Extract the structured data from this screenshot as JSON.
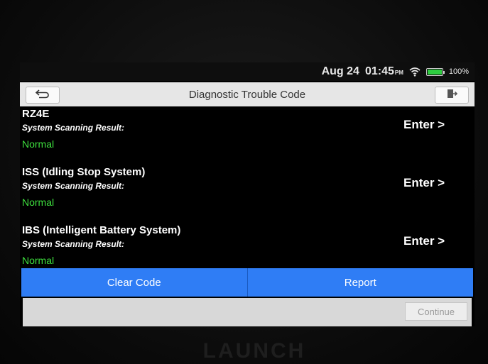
{
  "status_bar": {
    "date": "Aug 24",
    "time": "01:45",
    "ampm": "PM",
    "battery": "100%",
    "icons": [
      "wifi-icon",
      "battery-icon"
    ]
  },
  "title_bar": {
    "title": "Diagnostic Trouble Code",
    "back_icon": "back-arrow-icon",
    "exit_icon": "exit-icon"
  },
  "systems": [
    {
      "name": "RZ4E",
      "result_label": "System Scanning Result:",
      "status": "Normal",
      "enter_label": "Enter >"
    },
    {
      "name": "ISS (Idling Stop System)",
      "result_label": "System Scanning Result:",
      "status": "Normal",
      "enter_label": "Enter >"
    },
    {
      "name": "IBS (Intelligent Battery System)",
      "result_label": "System Scanning Result:",
      "status": "Normal",
      "enter_label": "Enter >"
    }
  ],
  "actions": {
    "clear_code": "Clear Code",
    "report": "Report",
    "continue": "Continue"
  },
  "brand": "LAUNCH",
  "colors": {
    "accent": "#2f7df5",
    "status_normal": "#3ee03e",
    "battery": "#2ecc40"
  }
}
